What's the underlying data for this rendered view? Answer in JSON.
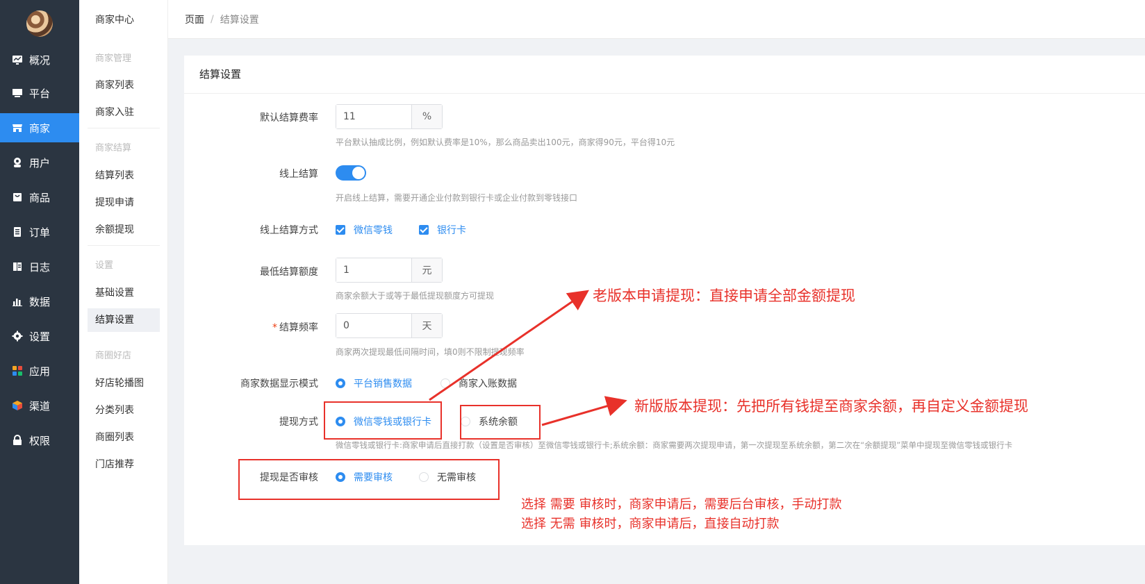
{
  "rail": {
    "items": [
      {
        "label": "概况",
        "icon": "monitor-chart-icon"
      },
      {
        "label": "平台",
        "icon": "desktop-icon"
      },
      {
        "label": "商家",
        "icon": "store-icon",
        "active": true
      },
      {
        "label": "用户",
        "icon": "user-icon"
      },
      {
        "label": "商品",
        "icon": "goods-icon"
      },
      {
        "label": "订单",
        "icon": "order-icon"
      },
      {
        "label": "日志",
        "icon": "log-icon"
      },
      {
        "label": "数据",
        "icon": "bar-chart-icon"
      },
      {
        "label": "设置",
        "icon": "gear-icon"
      },
      {
        "label": "应用",
        "icon": "apps-icon"
      },
      {
        "label": "渠道",
        "icon": "channel-cube-icon"
      },
      {
        "label": "权限",
        "icon": "lock-icon"
      }
    ]
  },
  "submenu": {
    "title": "商家中心",
    "groups": [
      {
        "label": "商家管理",
        "items": [
          "商家列表",
          "商家入驻"
        ]
      },
      {
        "label": "商家结算",
        "items": [
          "结算列表",
          "提现申请",
          "余额提现"
        ]
      },
      {
        "label": "设置",
        "items": [
          "基础设置",
          "结算设置"
        ]
      },
      {
        "label": "商圈好店",
        "items": [
          "好店轮播图",
          "分类列表",
          "商圈列表",
          "门店推荐"
        ]
      }
    ],
    "active": "结算设置"
  },
  "breadcrumb": {
    "root": "页面",
    "separator": "/",
    "current": "结算设置"
  },
  "card": {
    "title": "结算设置"
  },
  "form": {
    "rate": {
      "label": "默认结算费率",
      "value": "11",
      "unit": "%",
      "hint": "平台默认抽成比例，例如默认费率是10%，那么商品卖出100元，商家得90元，平台得10元"
    },
    "online": {
      "label": "线上结算",
      "enabled": true,
      "hint": "开启线上结算，需要开通企业付款到银行卡或企业付款到零钱接口"
    },
    "online_method": {
      "label": "线上结算方式",
      "options": [
        "微信零钱",
        "银行卡"
      ]
    },
    "min_amount": {
      "label": "最低结算额度",
      "value": "1",
      "unit": "元",
      "hint": "商家余额大于或等于最低提现额度方可提现"
    },
    "frequency": {
      "label": "结算频率",
      "required_mark": "*",
      "value": "0",
      "unit": "天",
      "hint": "商家两次提现最低间隔时间，填0则不限制提现频率"
    },
    "display_mode": {
      "label": "商家数据显示模式",
      "options": [
        "平台销售数据",
        "商家入账数据"
      ],
      "selected": "平台销售数据"
    },
    "withdraw_method": {
      "label": "提现方式",
      "options": [
        "微信零钱或银行卡",
        "系统余额"
      ],
      "selected": "微信零钱或银行卡",
      "hint": "微信零钱或银行卡:商家申请后直接打款（设置是否审核）至微信零钱或银行卡;系统余额：商家需要两次提现申请，第一次提现至系统余额，第二次在“余额提现”菜单中提现至微信零钱或银行卡"
    },
    "audit": {
      "label": "提现是否审核",
      "options": [
        "需要审核",
        "无需审核"
      ],
      "selected": "需要审核"
    }
  },
  "annotations": {
    "old_version": "老版本申请提现：直接申请全部金额提现",
    "new_version": "新版版本提现：先把所有钱提至商家余额，再自定义金额提现",
    "audit_note_1": "选择 需要 审核时，商家申请后，需要后台审核，手动打款",
    "audit_note_2": "选择 无需 审核时，商家申请后，直接自动打款",
    "color": "#e8312a"
  },
  "colors": {
    "rail_bg": "#2b3541",
    "accent": "#2d8cf0"
  }
}
